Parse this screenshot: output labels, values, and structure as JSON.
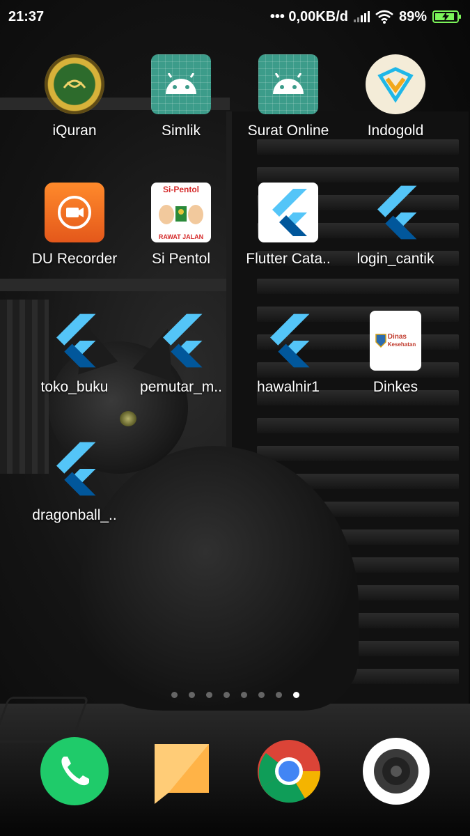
{
  "status_bar": {
    "time": "21:37",
    "network_speed": "••• 0,00KB/d",
    "battery_percent": "89%",
    "battery_level": 0.89,
    "signal_icon": "signal-icon",
    "wifi_icon": "wifi-icon",
    "battery_icon": "battery-charging-icon",
    "accent": "#7cf55a"
  },
  "apps": [
    {
      "label": "iQuran",
      "icon": "quran-icon"
    },
    {
      "label": "Simlik",
      "icon": "android-icon"
    },
    {
      "label": "Surat Online",
      "icon": "android-icon"
    },
    {
      "label": "Indogold",
      "icon": "indogold-icon"
    },
    {
      "label": "DU Recorder",
      "icon": "recorder-icon"
    },
    {
      "label": "Si Pentol",
      "icon": "si-pentol-icon",
      "logo_title": "Si-Pentol",
      "logo_caption": "RAWAT JALAN"
    },
    {
      "label": "Flutter Cata..",
      "icon": "flutter-icon"
    },
    {
      "label": "login_cantik",
      "icon": "flutter-icon"
    },
    {
      "label": "toko_buku",
      "icon": "flutter-icon"
    },
    {
      "label": "pemutar_m..",
      "icon": "flutter-icon"
    },
    {
      "label": "hawalnir1",
      "icon": "flutter-icon"
    },
    {
      "label": "Dinkes",
      "icon": "dinkes-icon",
      "logo_title": "Dinas",
      "logo_subtitle": "Kesehatan"
    },
    {
      "label": "dragonball_..",
      "icon": "flutter-icon"
    }
  ],
  "page_indicator": {
    "total": 8,
    "active_index": 7
  },
  "dock": [
    {
      "icon": "phone-icon",
      "color": "#1fcb6a"
    },
    {
      "icon": "messages-icon",
      "color": "#ffbe55"
    },
    {
      "icon": "chrome-icon",
      "color": "#4285f4"
    },
    {
      "icon": "camera-icon",
      "color": "#ffffff"
    }
  ]
}
